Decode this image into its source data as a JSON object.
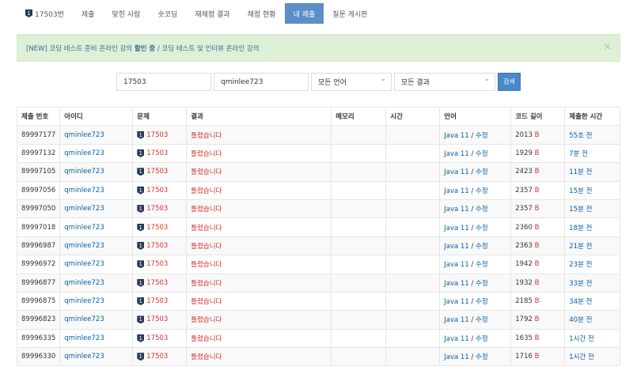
{
  "nav": {
    "problem_badge": "1",
    "items": [
      "17503번",
      "제출",
      "맞힌 사람",
      "숏코딩",
      "재채점 결과",
      "채점 현황",
      "내 제출",
      "질문 게시판"
    ],
    "active": 6
  },
  "alert": {
    "prefix": "[NEW] 코딩 테스트 준비 온라인 강의 ",
    "bold": "할인 중",
    "suffix": " / 코딩 테스트 및 인터뷰 온라인 강의",
    "close": "×"
  },
  "search": {
    "problem": "17503",
    "user": "qminlee723",
    "language": "모든 언어",
    "result": "모든 결과",
    "button": "검색"
  },
  "table": {
    "headers": [
      "제출 번호",
      "아이디",
      "문제",
      "결과",
      "메모리",
      "시간",
      "언어",
      "코드 길이",
      "제출한 시간"
    ],
    "rows": [
      {
        "id": "89997177",
        "user": "qminlee723",
        "problem": "17503",
        "result": "틀렸습니다",
        "lang": "Java 11",
        "edit": "수정",
        "len": "2013",
        "unit": "B",
        "time": "55초 전"
      },
      {
        "id": "89997132",
        "user": "qminlee723",
        "problem": "17503",
        "result": "틀렸습니다",
        "lang": "Java 11",
        "edit": "수정",
        "len": "1929",
        "unit": "B",
        "time": "7분 전"
      },
      {
        "id": "89997105",
        "user": "qminlee723",
        "problem": "17503",
        "result": "틀렸습니다",
        "lang": "Java 11",
        "edit": "수정",
        "len": "2423",
        "unit": "B",
        "time": "11분 전"
      },
      {
        "id": "89997056",
        "user": "qminlee723",
        "problem": "17503",
        "result": "틀렸습니다",
        "lang": "Java 11",
        "edit": "수정",
        "len": "2357",
        "unit": "B",
        "time": "15분 전"
      },
      {
        "id": "89997050",
        "user": "qminlee723",
        "problem": "17503",
        "result": "틀렸습니다",
        "lang": "Java 11",
        "edit": "수정",
        "len": "2357",
        "unit": "B",
        "time": "15분 전"
      },
      {
        "id": "89997018",
        "user": "qminlee723",
        "problem": "17503",
        "result": "틀렸습니다",
        "lang": "Java 11",
        "edit": "수정",
        "len": "2360",
        "unit": "B",
        "time": "18분 전"
      },
      {
        "id": "89996987",
        "user": "qminlee723",
        "problem": "17503",
        "result": "틀렸습니다",
        "lang": "Java 11",
        "edit": "수정",
        "len": "2363",
        "unit": "B",
        "time": "21분 전"
      },
      {
        "id": "89996972",
        "user": "qminlee723",
        "problem": "17503",
        "result": "틀렸습니다",
        "lang": "Java 11",
        "edit": "수정",
        "len": "1942",
        "unit": "B",
        "time": "23분 전"
      },
      {
        "id": "89996877",
        "user": "qminlee723",
        "problem": "17503",
        "result": "틀렸습니다",
        "lang": "Java 11",
        "edit": "수정",
        "len": "1932",
        "unit": "B",
        "time": "33분 전"
      },
      {
        "id": "89996875",
        "user": "qminlee723",
        "problem": "17503",
        "result": "틀렸습니다",
        "lang": "Java 11",
        "edit": "수정",
        "len": "2185",
        "unit": "B",
        "time": "34분 전"
      },
      {
        "id": "89996823",
        "user": "qminlee723",
        "problem": "17503",
        "result": "틀렸습니다",
        "lang": "Java 11",
        "edit": "수정",
        "len": "1792",
        "unit": "B",
        "time": "40분 전"
      },
      {
        "id": "89996335",
        "user": "qminlee723",
        "problem": "17503",
        "result": "틀렸습니다",
        "lang": "Java 11",
        "edit": "수정",
        "len": "1635",
        "unit": "B",
        "time": "1시간 전"
      },
      {
        "id": "89996330",
        "user": "qminlee723",
        "problem": "17503",
        "result": "틀렸습니다",
        "lang": "Java 11",
        "edit": "수정",
        "len": "1716",
        "unit": "B",
        "time": "1시간 전"
      }
    ]
  }
}
